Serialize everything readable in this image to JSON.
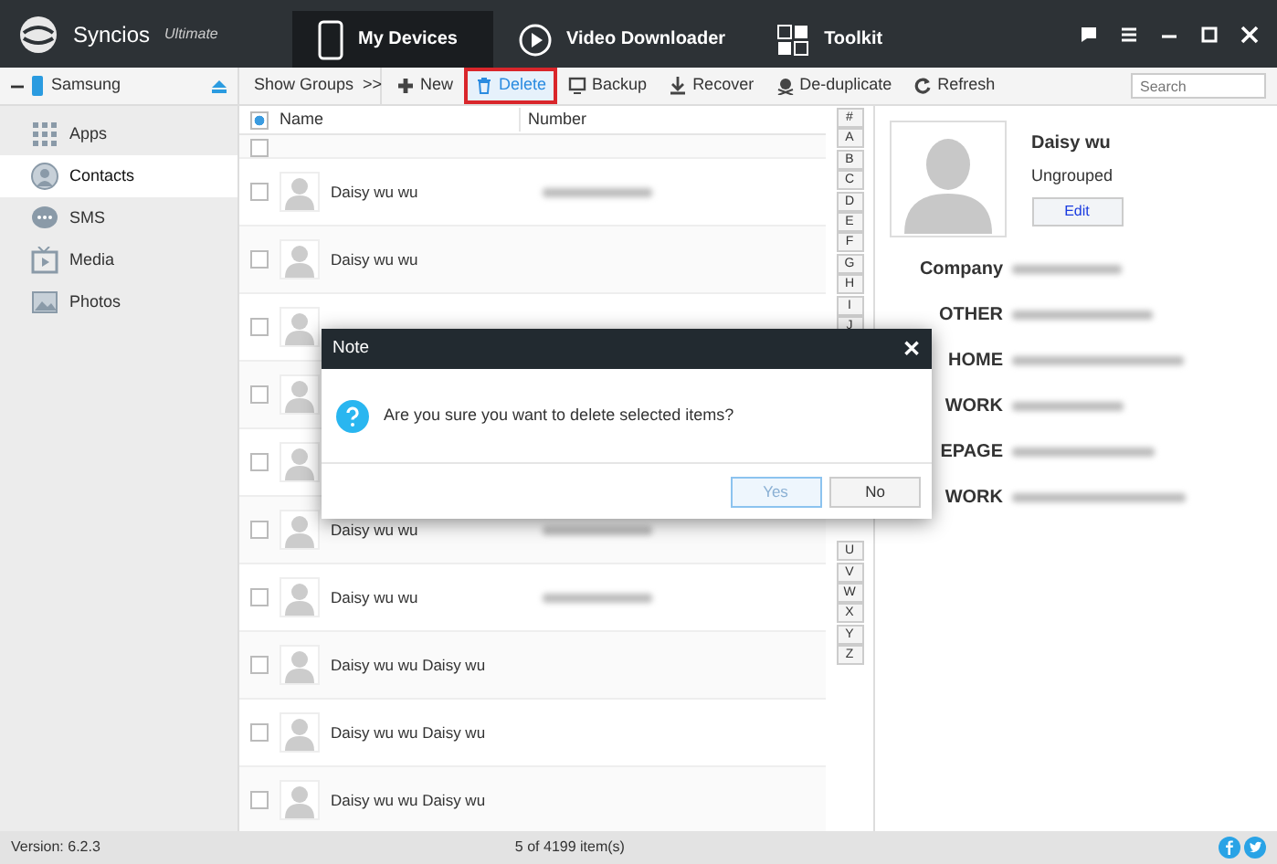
{
  "app": {
    "name": "Syncios",
    "edition": "Ultimate"
  },
  "tabs": [
    {
      "label": "My Devices",
      "selected": true,
      "kind": "phone"
    },
    {
      "label": "Video Downloader",
      "selected": false,
      "kind": "play"
    },
    {
      "label": "Toolkit",
      "selected": false,
      "kind": "grid"
    }
  ],
  "device": {
    "name": "Samsung"
  },
  "sidebar": {
    "items": [
      {
        "label": "Apps",
        "selected": false,
        "kind": "apps"
      },
      {
        "label": "Contacts",
        "selected": true,
        "kind": "contacts"
      },
      {
        "label": "SMS",
        "selected": false,
        "kind": "sms"
      },
      {
        "label": "Media",
        "selected": false,
        "kind": "media"
      },
      {
        "label": "Photos",
        "selected": false,
        "kind": "photos"
      }
    ]
  },
  "toolbar": {
    "show_groups": "Show Groups  >>",
    "buttons": [
      {
        "label": "New",
        "kind": "plus",
        "highlighted": false
      },
      {
        "label": "Delete",
        "kind": "trash",
        "highlighted": true
      },
      {
        "label": "Backup",
        "kind": "backup",
        "highlighted": false
      },
      {
        "label": "Recover",
        "kind": "download",
        "highlighted": false
      },
      {
        "label": "De-duplicate",
        "kind": "dedupe",
        "highlighted": false
      },
      {
        "label": "Refresh",
        "kind": "refresh",
        "highlighted": false
      }
    ],
    "search": {
      "placeholder": "Search"
    }
  },
  "table": {
    "columns": [
      "Name",
      "Number"
    ],
    "select_all": {
      "indeterminate": true
    },
    "rows": [
      {
        "checked": false,
        "kind": "cut"
      },
      {
        "name": "Daisy wu wu",
        "blurred_number": true,
        "checked": false,
        "kind": "row"
      },
      {
        "name": "Daisy wu wu",
        "blurred_number": false,
        "checked": false,
        "kind": "row"
      },
      {
        "checked": false,
        "kind": "row"
      },
      {
        "checked": false,
        "kind": "row"
      },
      {
        "checked": false,
        "kind": "row"
      },
      {
        "name": "Daisy wu wu",
        "blurred_number": true,
        "checked": false,
        "kind": "row"
      },
      {
        "name": "Daisy wu wu",
        "blurred_number": true,
        "checked": false,
        "kind": "row"
      },
      {
        "name": "Daisy wu wu Daisy wu",
        "blurred_number": false,
        "checked": false,
        "kind": "row"
      },
      {
        "name": "Daisy wu wu Daisy wu",
        "blurred_number": false,
        "checked": false,
        "kind": "row"
      },
      {
        "name": "Daisy wu wu Daisy wu",
        "blurred_number": false,
        "checked": false,
        "kind": "row"
      }
    ]
  },
  "alphabet": {
    "top": [
      "#",
      "A",
      "B",
      "C",
      "D",
      "E",
      "F",
      "G",
      "H",
      "I",
      "J"
    ],
    "bottom": [
      "U",
      "V",
      "W",
      "X",
      "Y",
      "Z"
    ]
  },
  "detail": {
    "name": "Daisy wu",
    "group": "Ungrouped",
    "edit": "Edit",
    "fields": [
      {
        "label": "Company"
      },
      {
        "label": "OTHER"
      },
      {
        "label": "HOME"
      },
      {
        "label": "WORK"
      },
      {
        "label": "EPAGE"
      },
      {
        "label": "WORK"
      }
    ]
  },
  "dialog": {
    "title": "Note",
    "close": "✕",
    "message": "Are you sure you want to delete selected items?",
    "buttons": [
      {
        "label": "Yes",
        "focused": true
      },
      {
        "label": "No",
        "focused": false
      }
    ]
  },
  "status_bar": {
    "version": "Version: 6.2.3",
    "count": "5 of 4199 item(s)"
  }
}
